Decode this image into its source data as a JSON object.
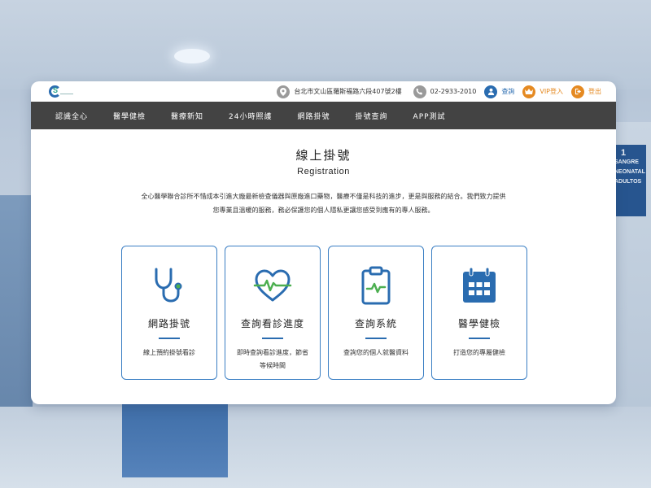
{
  "topbar": {
    "address": "台北市文山區羅斯福路六段407號2樓",
    "phone": "02-2933-2010",
    "query_label": "查詢",
    "vip_label": "VIP登入",
    "logout_label": "登出"
  },
  "nav": {
    "items": [
      {
        "label": "認識全心"
      },
      {
        "label": "醫學健檢"
      },
      {
        "label": "醫療新知"
      },
      {
        "label": "24小時照護"
      },
      {
        "label": "網路掛號"
      },
      {
        "label": "掛號查詢"
      },
      {
        "label": "APP測試"
      }
    ]
  },
  "page": {
    "title_zh": "線上掛號",
    "title_en": "Registration",
    "intro_line1": "全心醫學聯合診所不惜成本引進大廠最新檢查儀器與原廠進口藥物，醫療不僅是科技的進步，更是與服務的結合。我們致力提供",
    "intro_line2": "您專業且溫暖的服務，務必保護您的個人隱私更讓您感受到應有的專人服務。"
  },
  "services": [
    {
      "icon": "stethoscope-icon",
      "title": "網路掛號",
      "desc": "線上預約掛號看診"
    },
    {
      "icon": "heart-pulse-icon",
      "title": "查詢看診進度",
      "desc": "即時查詢看診進度，節省等候時間"
    },
    {
      "icon": "clipboard-pulse-icon",
      "title": "查詢系統",
      "desc": "查詢您的個人就醫資料"
    },
    {
      "icon": "calendar-icon",
      "title": "醫學健檢",
      "desc": "打造您的專屬健檢"
    }
  ],
  "background_sign": {
    "number": "1",
    "line1": "SANGRE",
    "line2": "NEONATAL",
    "line3": "ADULTOS"
  },
  "colors": {
    "accent_blue": "#2a6cb0",
    "accent_orange": "#e58a22",
    "nav_bg": "#434343",
    "box_border": "#3b7fc4",
    "pulse_green": "#4caf50"
  }
}
